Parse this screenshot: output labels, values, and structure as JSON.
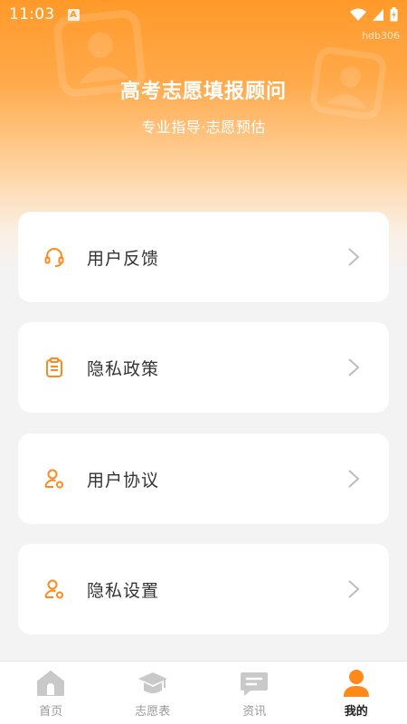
{
  "status": {
    "time": "11:03",
    "notif_glyph": "A",
    "watermark": "hdb306",
    "icons": [
      "wifi-icon",
      "signal-icon",
      "battery-icon"
    ]
  },
  "hero": {
    "title": "高考志愿填报顾问",
    "subtitle": "专业指导·志愿预估"
  },
  "colors": {
    "accent": "#ff8a1a",
    "card_bg": "#ffffff",
    "page_bg": "#f3f3f3",
    "text": "#333333",
    "chevron": "#bdbdbd"
  },
  "menu": [
    {
      "label": "用户反馈",
      "icon": "headset-icon"
    },
    {
      "label": "隐私政策",
      "icon": "clipboard-icon"
    },
    {
      "label": "用户协议",
      "icon": "user-shield-icon"
    },
    {
      "label": "隐私设置",
      "icon": "user-settings-icon"
    }
  ],
  "tabbar": {
    "active_index": 3,
    "tabs": [
      {
        "label": "首页",
        "icon": "home-icon"
      },
      {
        "label": "志愿表",
        "icon": "graduation-cap-icon"
      },
      {
        "label": "资讯",
        "icon": "message-icon"
      },
      {
        "label": "我的",
        "icon": "profile-icon"
      }
    ]
  }
}
